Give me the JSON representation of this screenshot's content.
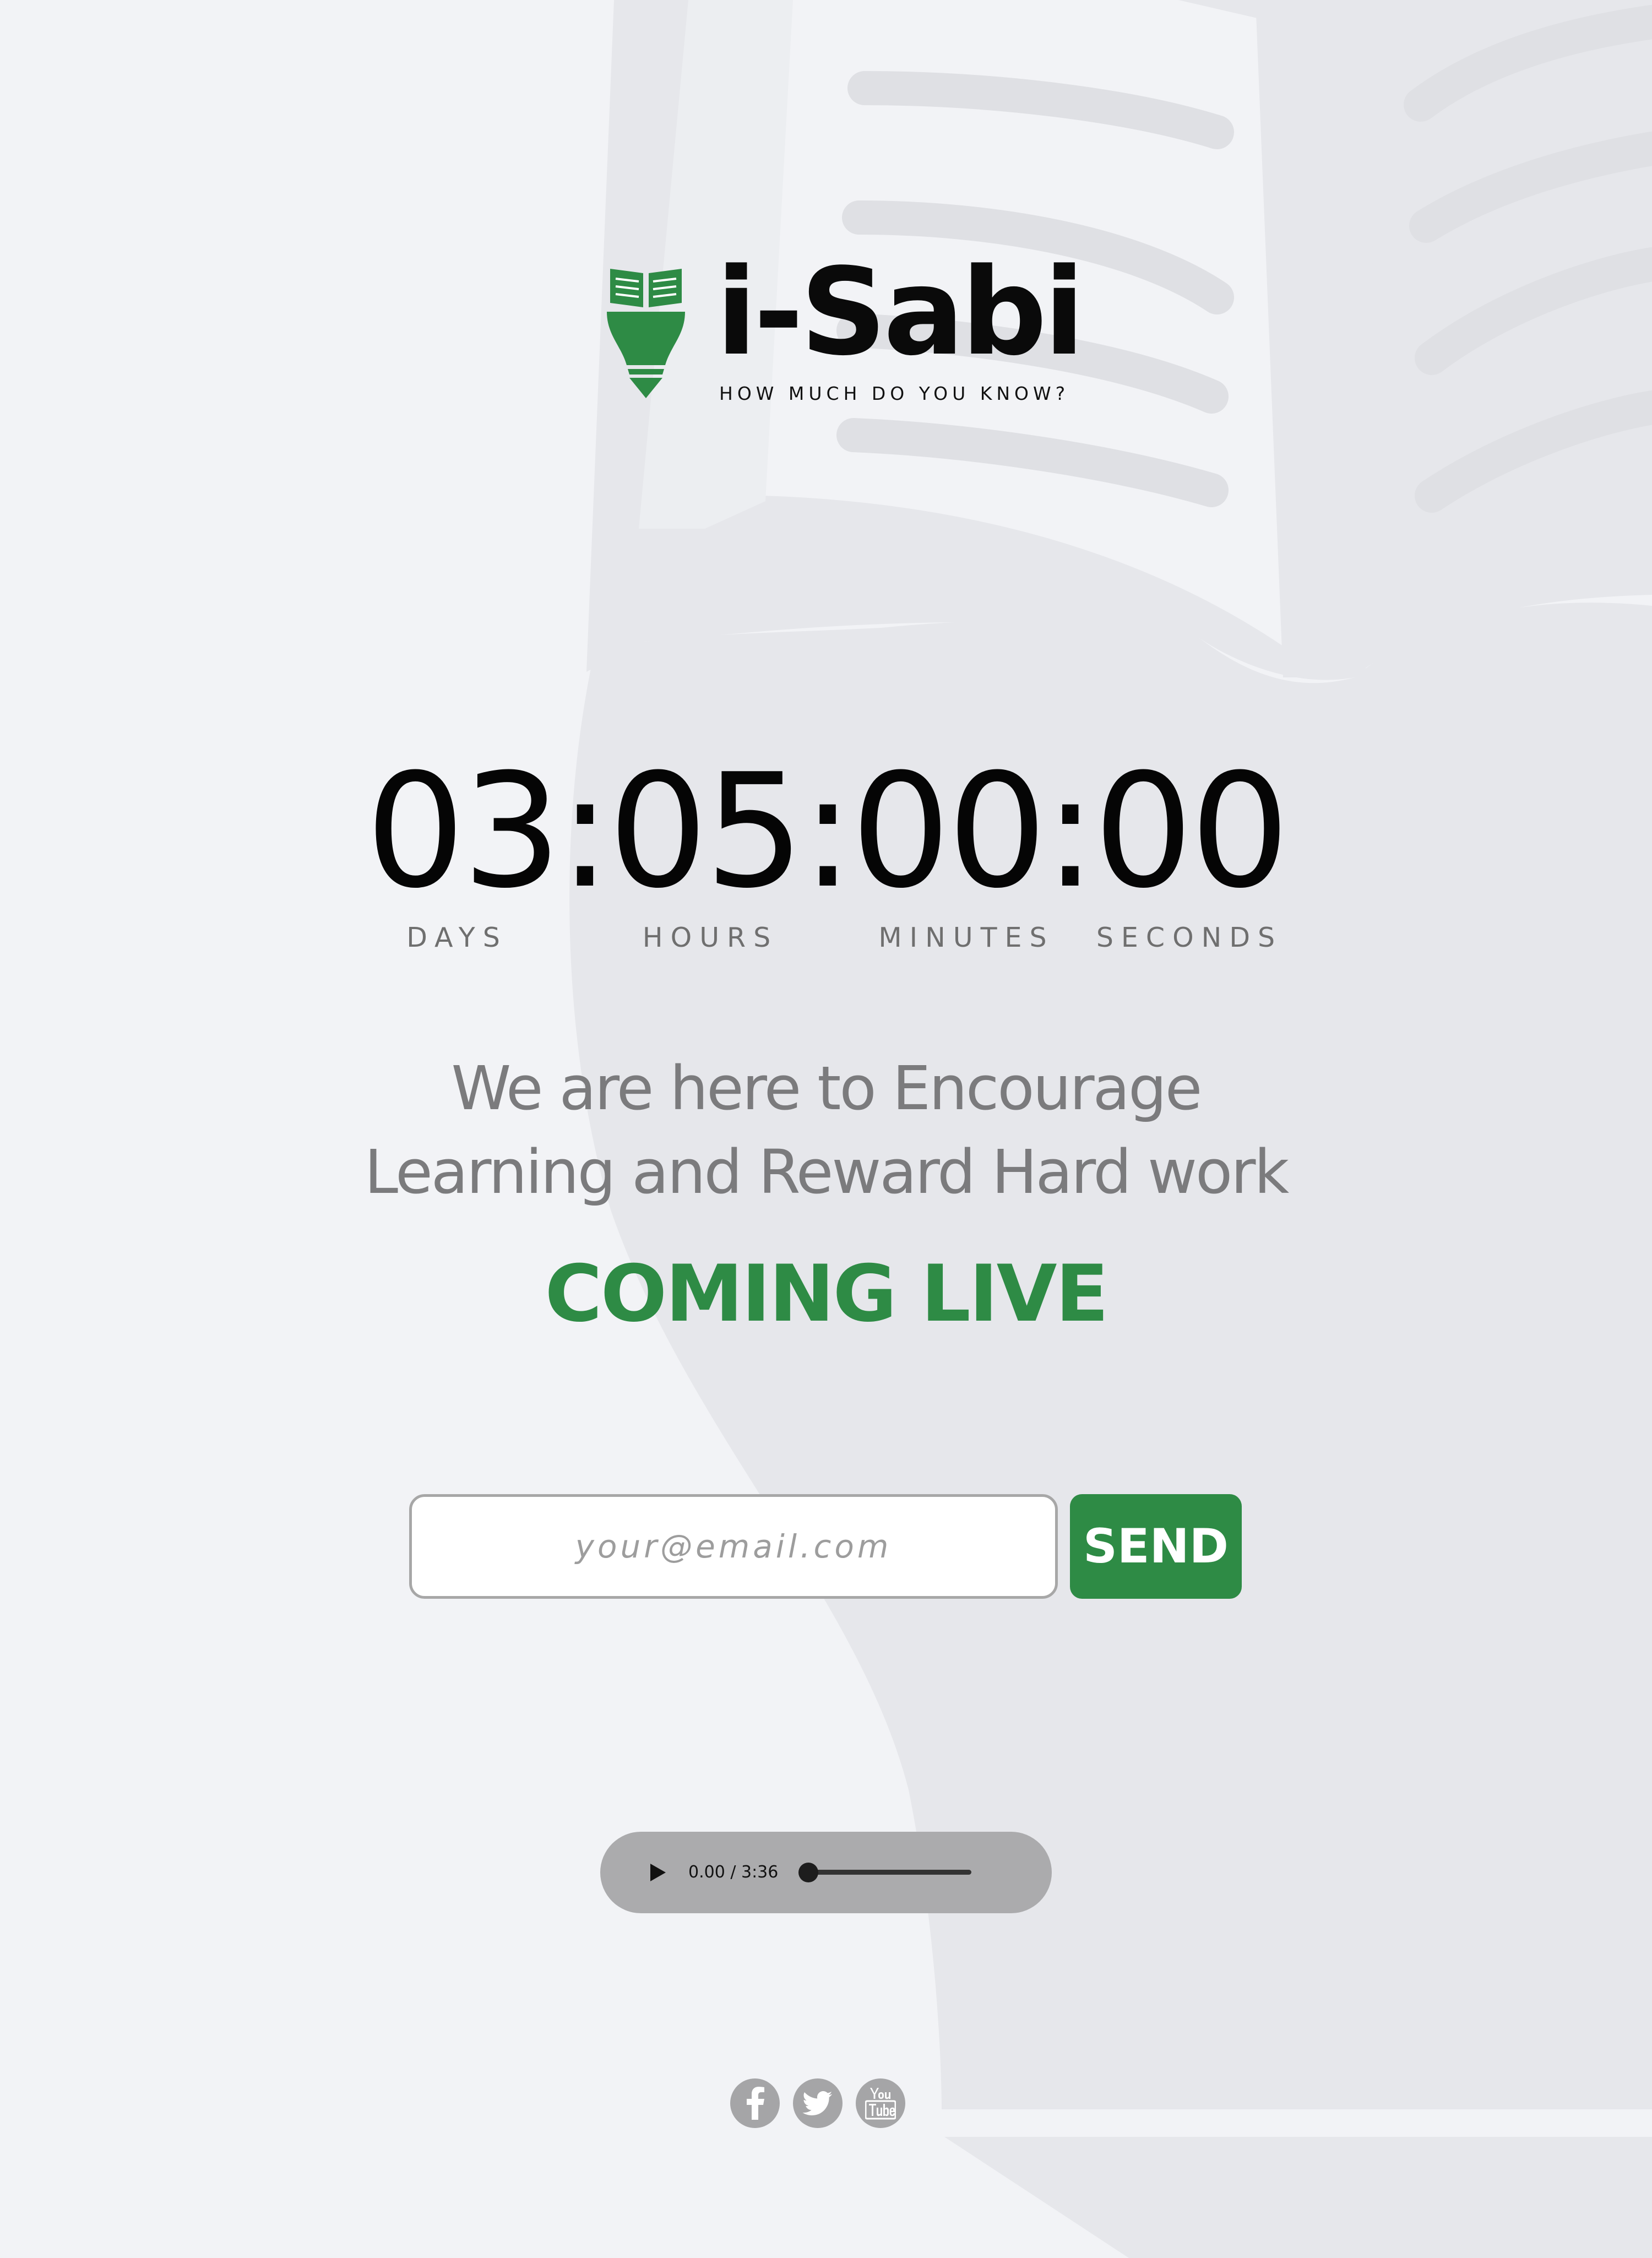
{
  "brand": {
    "name": "i-Sabi",
    "tagline": "HOW MUCH DO YOU KNOW?",
    "logo_icon": "book-bulb-icon",
    "accent_color": "#2e8b45"
  },
  "countdown": {
    "text": "03:05:00:00",
    "days": "03",
    "hours": "05",
    "minutes": "00",
    "seconds": "00",
    "labels": {
      "days": "DAYS",
      "hours": "HOURS",
      "minutes": "MINUTES",
      "seconds": "SECONDS"
    }
  },
  "headline": {
    "line1": "We are here to Encourage",
    "line2": "Learning and Reward Hard work"
  },
  "coming_live": "COMING LIVE",
  "subscribe": {
    "placeholder": "your@email.com",
    "value": "",
    "button_label": "SEND"
  },
  "audio": {
    "time_display": "0.00 / 3:36",
    "progress": 0,
    "play_icon": "play-icon"
  },
  "social": [
    {
      "name": "facebook",
      "icon": "facebook-icon"
    },
    {
      "name": "twitter",
      "icon": "twitter-icon"
    },
    {
      "name": "youtube",
      "icon": "youtube-icon"
    }
  ],
  "colors": {
    "background": "#f2f3f6",
    "background_art": "#e6e7eb",
    "text_dark": "#050505",
    "text_muted": "#7b7b7d",
    "social_grey": "#a5a5a7"
  }
}
